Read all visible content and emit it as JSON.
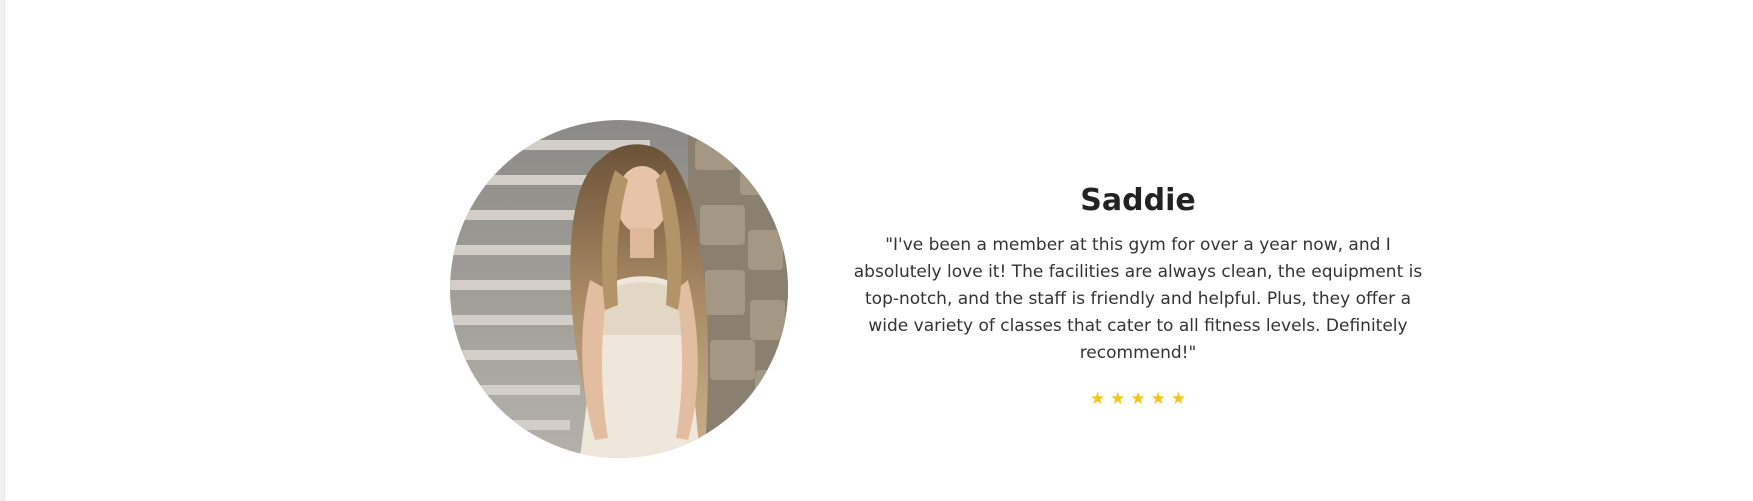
{
  "testimonial": {
    "name": "Saddie",
    "quote": "\"I've been a member at this gym for over a year now, and I absolutely love it! The facilities are always clean, the equipment is top-notch, and the staff is friendly and helpful. Plus, they offer a wide variety of classes that cater to all fitness levels. Definitely recommend!\"",
    "rating": 5,
    "star_glyph": "★",
    "star_color": "#f5c518",
    "avatar_icon": "user-photo"
  }
}
